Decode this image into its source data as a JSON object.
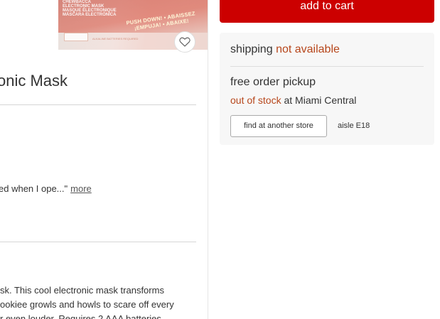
{
  "product": {
    "image": {
      "brand_text": "CHEWBACCA\nELECTRONIC MASK\nMASQUE ÉLECTRONIQUE\nMÁSCARA ELECTRÓNICA",
      "banner_line1": "PUSH DOWN! • ABAISSEZ",
      "banner_line2": "¡EMPUJA! • ABAIXE!",
      "footer_text": "ALKALINE BATTERIES REQUIRED"
    },
    "title": "onic Mask",
    "review": {
      "snippet": "ed when I ope...\"",
      "more_label": "more"
    },
    "description_lines": [
      "sk. This cool electronic mask transforms",
      "ookiee growls and howls to scare off every",
      "r even louder. Requires 2 AAA batteries"
    ]
  },
  "cart": {
    "add_label": "add to cart"
  },
  "fulfillment": {
    "shipping_label": "shipping",
    "shipping_status": "not available",
    "pickup_title": "free order pickup",
    "stock_status": "out of stock",
    "stock_location": "at Miami Central",
    "find_store_label": "find at another store",
    "aisle": "aisle E18"
  },
  "colors": {
    "brand_red": "#cc0000",
    "status_orange": "#b7471c",
    "panel_bg": "#f7f7f7"
  },
  "icons": {
    "favorite": "heart-icon"
  }
}
